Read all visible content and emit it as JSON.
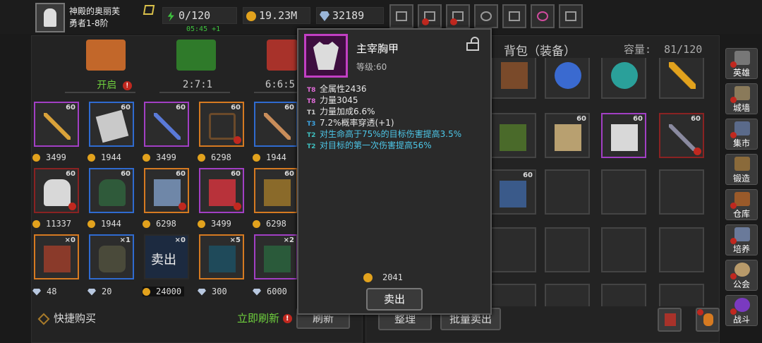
{
  "player": {
    "name": "神殿的奥丽芙",
    "title": "勇者1-8阶"
  },
  "resources": {
    "energy": "0/120",
    "energy_timer": "05:45 +1",
    "gold": "19.23M",
    "diamonds": "32189"
  },
  "top_buttons": [
    "shop-cart-icon",
    "mail-icon",
    "gamepad-icon",
    "settings-gear-icon",
    "gift-icon",
    "lucky-wheel-icon",
    "fireworks-icon"
  ],
  "chests": {
    "items": [
      {
        "label": "开启",
        "color": "#c2672a"
      },
      {
        "label": "2:7:1",
        "color": "#2f7a2a"
      },
      {
        "label": "6:6:5",
        "color": "#a8322a"
      }
    ]
  },
  "shop": {
    "rows": [
      [
        {
          "level": "60",
          "quality": "purple",
          "price": "3499",
          "currency": "coin"
        },
        {
          "level": "60",
          "quality": "blue",
          "price": "1944",
          "currency": "coin"
        },
        {
          "level": "60",
          "quality": "purple",
          "price": "3499",
          "currency": "coin"
        },
        {
          "level": "60",
          "quality": "orange",
          "price": "6298",
          "currency": "coin"
        },
        {
          "level": "60",
          "quality": "blue",
          "price": "1944",
          "currency": "coin"
        }
      ],
      [
        {
          "level": "60",
          "quality": "red",
          "price": "11337",
          "currency": "coin"
        },
        {
          "level": "60",
          "quality": "blue",
          "price": "1944",
          "currency": "coin"
        },
        {
          "level": "60",
          "quality": "orange",
          "price": "6298",
          "currency": "coin"
        },
        {
          "level": "60",
          "quality": "purple",
          "price": "3499",
          "currency": "coin"
        },
        {
          "level": "60",
          "quality": "orange",
          "price": "6298",
          "currency": "coin"
        }
      ],
      [
        {
          "level": "×0",
          "quality": "orange",
          "price": "48",
          "currency": "gem"
        },
        {
          "level": "×1",
          "quality": "blue",
          "price": "20",
          "currency": "gem"
        },
        {
          "level": "×0",
          "quality": "sold",
          "price": "24000",
          "currency": "coin",
          "overlay": "卖出"
        },
        {
          "level": "×5",
          "quality": "orange",
          "price": "300",
          "currency": "gem"
        },
        {
          "level": "×2",
          "quality": "purple",
          "price": "6000",
          "currency": "gem"
        }
      ]
    ]
  },
  "bottom_left": {
    "quick_buy": "快捷购买",
    "refresh_now": "立即刷新",
    "refresh": "刷新"
  },
  "bag": {
    "title": "背包（装备）",
    "capacity_label": "容量:",
    "capacity": "81/120",
    "sort": "整理",
    "bulk_sell": "批量卖出"
  },
  "sidebar": [
    "英雄",
    "城墙",
    "集市",
    "锻造",
    "仓库",
    "培养",
    "公会",
    "战斗"
  ],
  "tooltip": {
    "name": "主宰胸甲",
    "level": "等级:60",
    "lines": [
      {
        "tier": "T8",
        "text": "全属性2436",
        "tier_class": "t8",
        "text_class": "c-white"
      },
      {
        "tier": "T8",
        "text": "力量3045",
        "tier_class": "t8",
        "text_class": "c-white"
      },
      {
        "tier": "T1",
        "text": "力量加成6.6%",
        "tier_class": "t1",
        "text_class": "c-white"
      },
      {
        "tier": "T3",
        "text": "7.2%概率穿透(+1)",
        "tier_class": "t3",
        "text_class": "c-white"
      },
      {
        "tier": "T2",
        "text": "对生命高于75%的目标伤害提高3.5%",
        "tier_class": "t2",
        "text_class": "c-cyan"
      },
      {
        "tier": "T2",
        "text": "对目标的第一次伤害提高56%",
        "tier_class": "t2",
        "text_class": "c-cyan"
      }
    ],
    "price": "2041",
    "sell": "卖出"
  }
}
